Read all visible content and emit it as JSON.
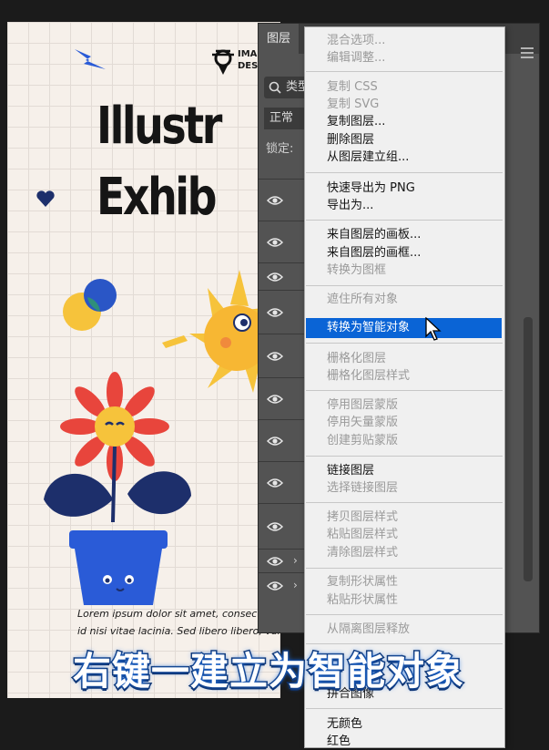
{
  "artboard": {
    "title_line1": "Illustr",
    "title_line2": "Exhib",
    "logo_text_1": "IMA",
    "logo_text_2": "DES",
    "body_line1": "Lorem ipsum dolor sit amet, consectetu",
    "body_line2": "id nisi vitae lacinia. Sed libero libero, varius at"
  },
  "layers_panel": {
    "tab_label": "图层",
    "search_label": "类型",
    "blend_mode": "正常",
    "lock_label": "锁定:"
  },
  "context_menu": {
    "items": [
      {
        "label": "混合选项...",
        "enabled": false
      },
      {
        "label": "编辑调整...",
        "enabled": false
      },
      {
        "label": "复制 CSS",
        "enabled": false
      },
      {
        "label": "复制 SVG",
        "enabled": false
      },
      {
        "label": "复制图层...",
        "enabled": true
      },
      {
        "label": "删除图层",
        "enabled": true
      },
      {
        "label": "从图层建立组...",
        "enabled": true
      },
      {
        "label": "快速导出为 PNG",
        "enabled": true
      },
      {
        "label": "导出为...",
        "enabled": true
      },
      {
        "label": "来自图层的画板...",
        "enabled": true
      },
      {
        "label": "来自图层的画框...",
        "enabled": true
      },
      {
        "label": "转换为图框",
        "enabled": false
      },
      {
        "label": "遮住所有对象",
        "enabled": false
      },
      {
        "label": "转换为智能对象",
        "enabled": true,
        "highlighted": true
      },
      {
        "label": "栅格化图层",
        "enabled": false
      },
      {
        "label": "栅格化图层样式",
        "enabled": false
      },
      {
        "label": "停用图层蒙版",
        "enabled": false
      },
      {
        "label": "停用矢量蒙版",
        "enabled": false
      },
      {
        "label": "创建剪贴蒙版",
        "enabled": false
      },
      {
        "label": "链接图层",
        "enabled": true
      },
      {
        "label": "选择链接图层",
        "enabled": false
      },
      {
        "label": "拷贝图层样式",
        "enabled": false
      },
      {
        "label": "粘贴图层样式",
        "enabled": false
      },
      {
        "label": "清除图层样式",
        "enabled": false
      },
      {
        "label": "复制形状属性",
        "enabled": false
      },
      {
        "label": "粘贴形状属性",
        "enabled": false
      },
      {
        "label": "从隔离图层释放",
        "enabled": false
      },
      {
        "label": "拼合图像",
        "enabled": true
      },
      {
        "label": "无颜色",
        "enabled": true
      },
      {
        "label": "红色",
        "enabled": true
      }
    ]
  },
  "caption": "右键一建立为智能对象",
  "colors": {
    "menu_highlight": "#0a64d6",
    "panel_bg": "#535353",
    "artboard_bg": "#f6f0ea",
    "caption_outline": "#0d2f66"
  }
}
